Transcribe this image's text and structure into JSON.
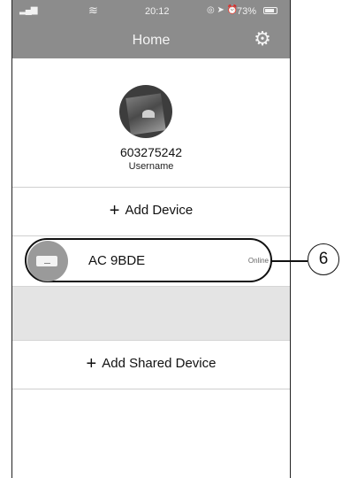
{
  "status_bar": {
    "signal": "▂▄▆",
    "wifi": "≋",
    "time": "20:12",
    "status_icons": "◎ ➤ ⏰",
    "battery_text": "73%"
  },
  "header": {
    "title": "Home",
    "settings_icon": "gear-icon",
    "settings_glyph": "⚙"
  },
  "profile": {
    "user_id": "603275242",
    "username_label": "Username"
  },
  "add_device": {
    "plus": "+",
    "label": "Add Device"
  },
  "devices": [
    {
      "name": "AC 9BDE",
      "status": "Online"
    }
  ],
  "add_shared_device": {
    "plus": "+",
    "label": "Add Shared Device"
  },
  "callout": {
    "label": "6"
  }
}
